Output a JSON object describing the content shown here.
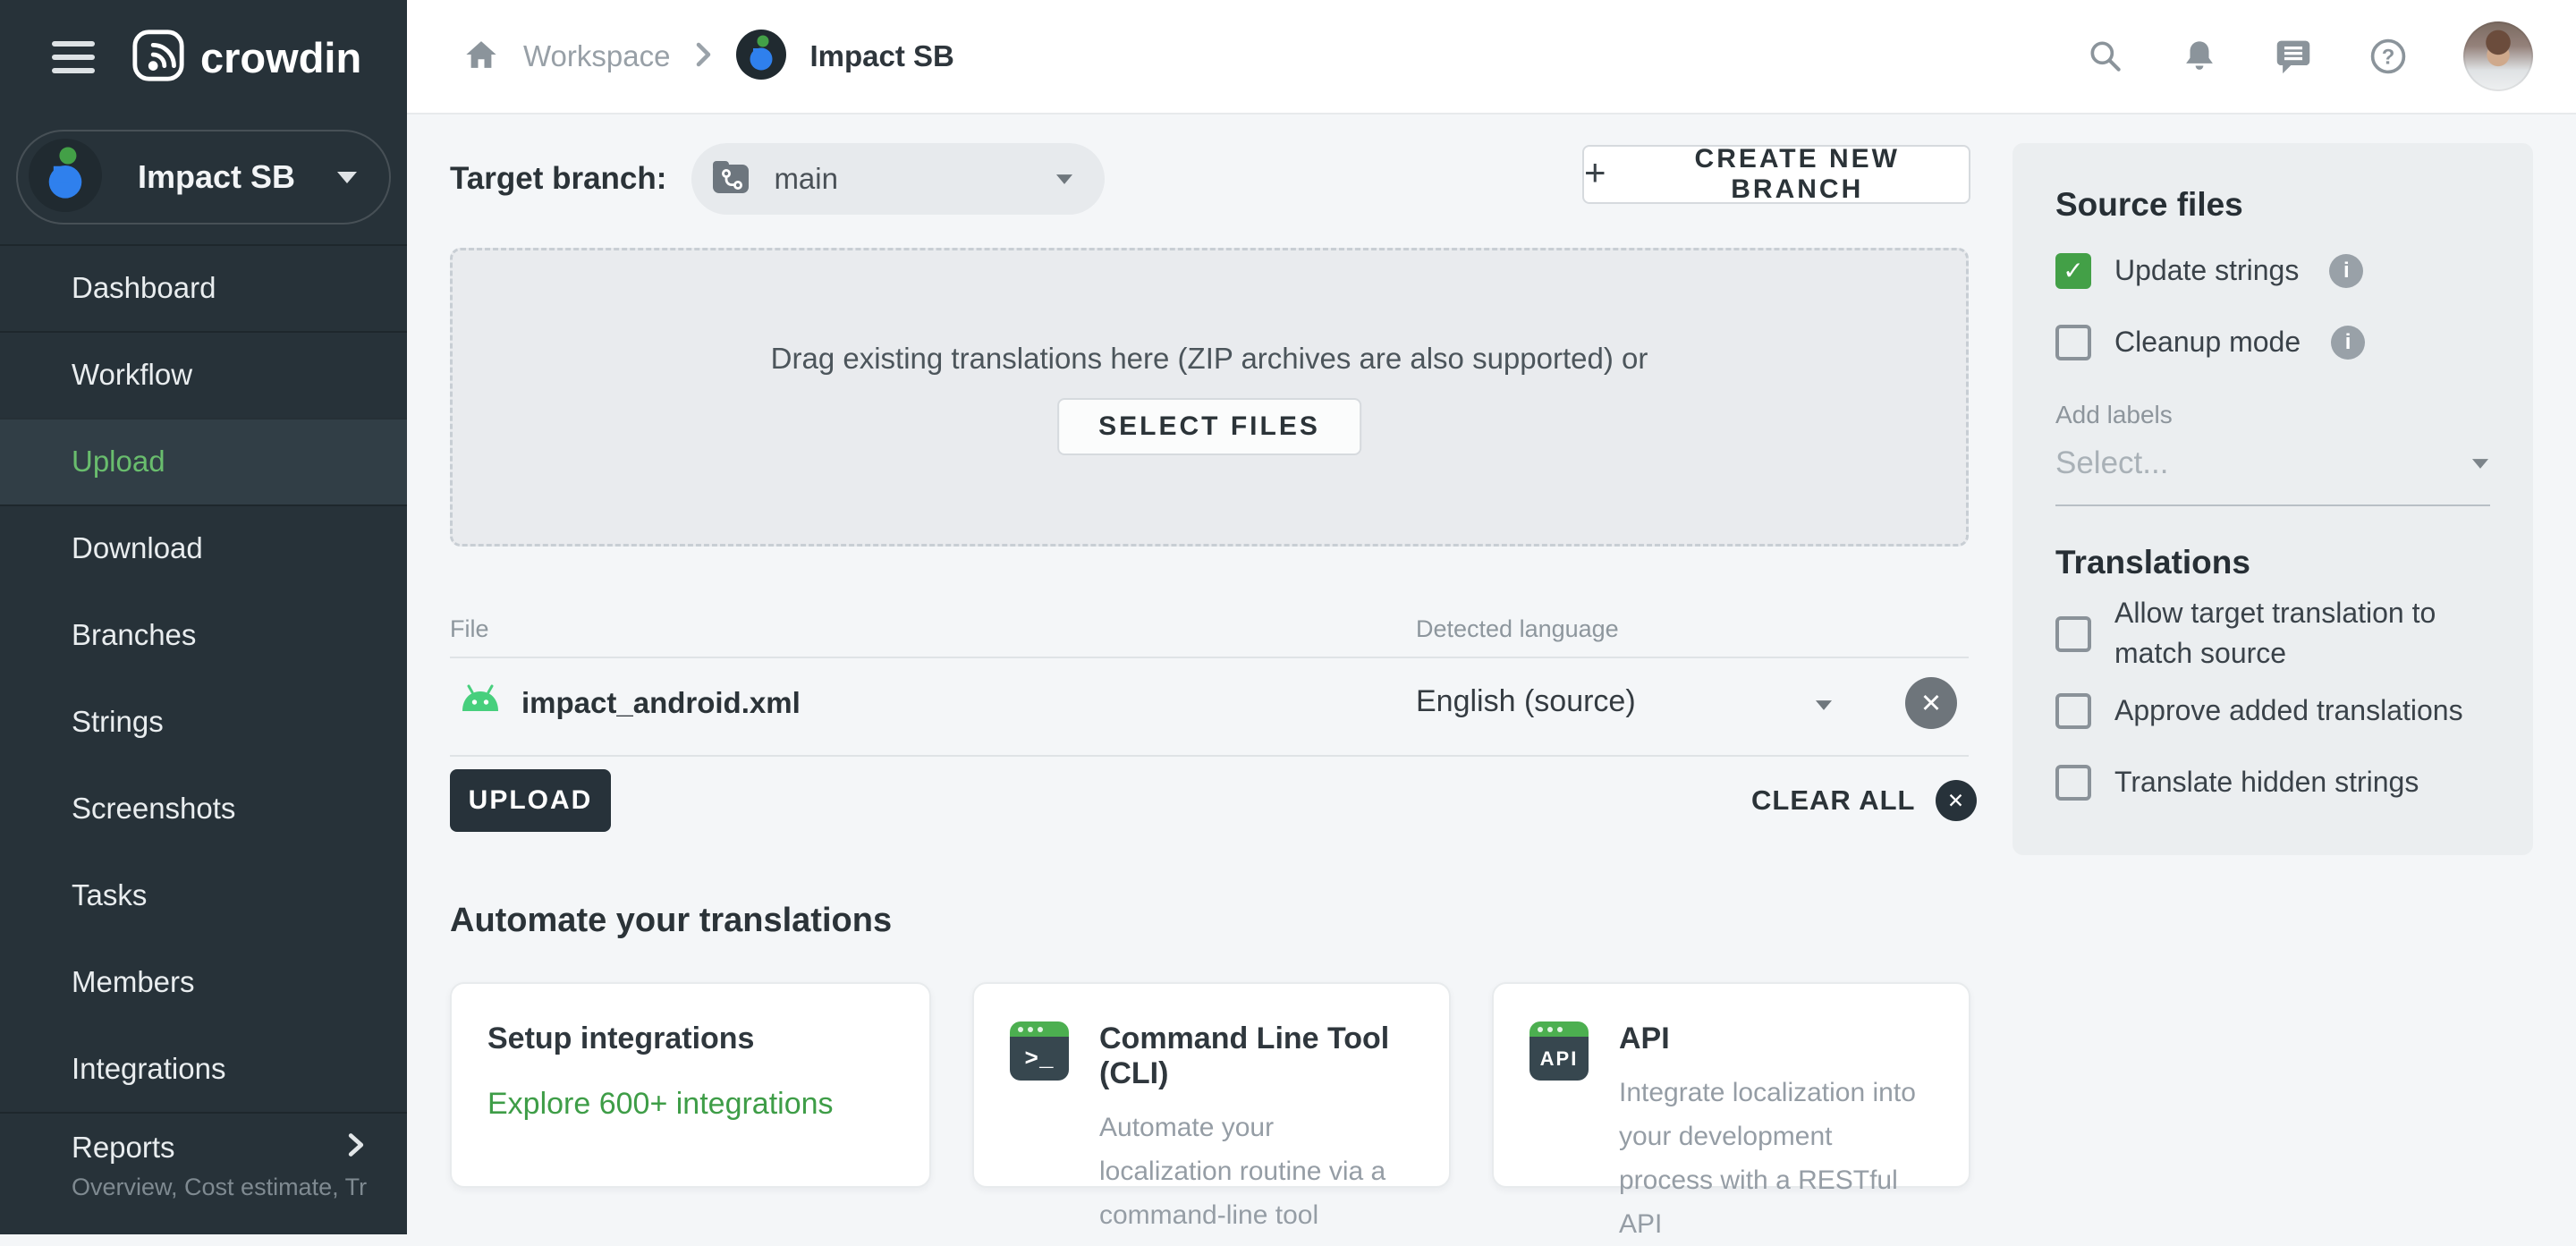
{
  "brand": {
    "logo_text": "crowdin"
  },
  "topbar": {
    "breadcrumb": {
      "workspace": "Workspace",
      "project": "Impact SB"
    }
  },
  "sidebar": {
    "project_name": "Impact SB",
    "items": [
      {
        "label": "Dashboard",
        "active": false
      },
      {
        "label": "Workflow",
        "active": false
      },
      {
        "label": "Upload",
        "active": true
      },
      {
        "label": "Download",
        "active": false
      },
      {
        "label": "Branches",
        "active": false
      },
      {
        "label": "Strings",
        "active": false
      },
      {
        "label": "Screenshots",
        "active": false
      },
      {
        "label": "Tasks",
        "active": false
      },
      {
        "label": "Members",
        "active": false
      },
      {
        "label": "Integrations",
        "active": false
      },
      {
        "label": "Reports",
        "active": false
      }
    ],
    "reports_subtext": "Overview, Cost estimate, Transl…"
  },
  "main": {
    "target_branch_label": "Target branch:",
    "branch_name": "main",
    "create_branch_label": "CREATE NEW BRANCH",
    "dropzone_text": "Drag existing translations here (ZIP archives are also supported) or",
    "select_files_label": "SELECT FILES",
    "table": {
      "headers": [
        "File",
        "Detected language"
      ],
      "rows": [
        {
          "file_name": "impact_android.xml",
          "detected_language": "English (source)"
        }
      ]
    },
    "upload_label": "UPLOAD",
    "clear_all_label": "CLEAR ALL",
    "automate_heading": "Automate your translations",
    "cards": [
      {
        "title": "Setup integrations",
        "link": "Explore 600+ integrations"
      },
      {
        "title": "Command Line Tool (CLI)",
        "description": "Automate your localization routine via a command-line tool"
      },
      {
        "title": "API",
        "description": "Integrate localization into your development process with a RESTful API"
      }
    ]
  },
  "panel": {
    "source_files_heading": "Source files",
    "options": [
      {
        "label": "Update strings",
        "checked": true
      },
      {
        "label": "Cleanup mode",
        "checked": false
      }
    ],
    "add_labels_label": "Add labels",
    "labels_placeholder": "Select...",
    "translations_heading": "Translations",
    "translation_options": [
      {
        "label": "Allow target translation to match source",
        "checked": false
      },
      {
        "label": "Approve added translations",
        "checked": false
      },
      {
        "label": "Translate hidden strings",
        "checked": false
      }
    ]
  },
  "icons": {
    "plus": "+",
    "check": "✓",
    "close": "✕",
    "info": "i",
    "question": "?",
    "terminal_prompt": ">_",
    "api_label": "API"
  },
  "colors": {
    "sidebar_bg": "#273239",
    "active_green": "#69bd6d",
    "accent_green": "#43a047",
    "dark_button": "#27323a",
    "page_bg": "#f4f6f8",
    "panel_bg": "#ebeef0",
    "android_green": "#47cf7d",
    "link_green": "#3e9d47"
  }
}
